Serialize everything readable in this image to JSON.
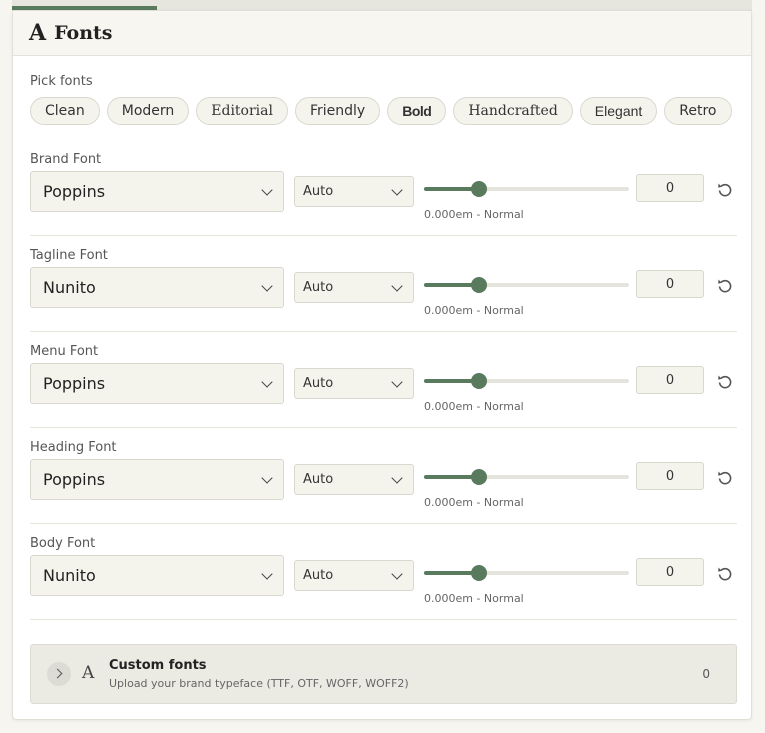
{
  "header": {
    "icon": "A",
    "title": "Fonts"
  },
  "pick_fonts": {
    "label": "Pick fonts",
    "presets": [
      "Clean",
      "Modern",
      "Editorial",
      "Friendly",
      "Bold",
      "Handcrafted",
      "Elegant",
      "Retro"
    ]
  },
  "rows": [
    {
      "label": "Brand Font",
      "family": "Poppins",
      "weight": "Auto",
      "slider_fraction": 0.27,
      "caption": "0.000em - Normal",
      "value": "0"
    },
    {
      "label": "Tagline Font",
      "family": "Nunito",
      "weight": "Auto",
      "slider_fraction": 0.27,
      "caption": "0.000em - Normal",
      "value": "0"
    },
    {
      "label": "Menu Font",
      "family": "Poppins",
      "weight": "Auto",
      "slider_fraction": 0.27,
      "caption": "0.000em - Normal",
      "value": "0"
    },
    {
      "label": "Heading Font",
      "family": "Poppins",
      "weight": "Auto",
      "slider_fraction": 0.27,
      "caption": "0.000em - Normal",
      "value": "0"
    },
    {
      "label": "Body Font",
      "family": "Nunito",
      "weight": "Auto",
      "slider_fraction": 0.27,
      "caption": "0.000em - Normal",
      "value": "0"
    }
  ],
  "custom_fonts": {
    "icon": "A",
    "title": "Custom fonts",
    "subtitle": "Upload your brand typeface (TTF, OTF, WOFF, WOFF2)",
    "count": "0"
  },
  "colors": {
    "accent": "#5a7a5e",
    "surface": "#f5f4ec",
    "panel": "#ffffff"
  }
}
